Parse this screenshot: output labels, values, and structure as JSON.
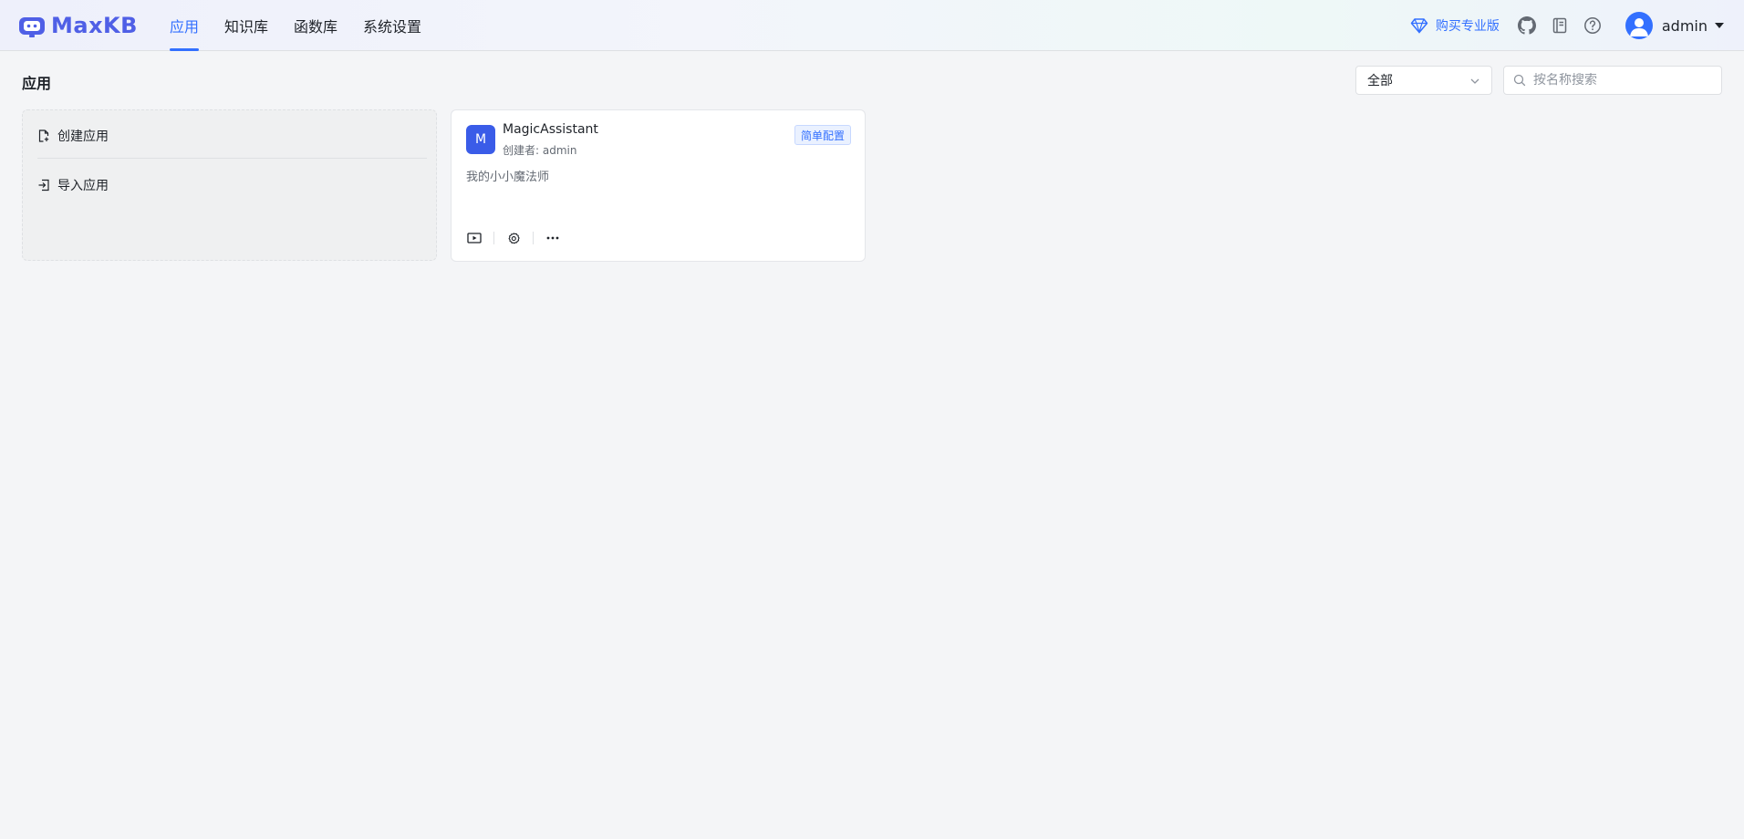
{
  "brand": {
    "name": "MaxKB",
    "color": "#4f5fe6"
  },
  "nav": {
    "items": [
      {
        "label": "应用",
        "active": true
      },
      {
        "label": "知识库",
        "active": false
      },
      {
        "label": "函数库",
        "active": false
      },
      {
        "label": "系统设置",
        "active": false
      }
    ]
  },
  "header": {
    "buy_pro": "购买专业版",
    "icons": [
      "github-icon",
      "book-icon",
      "help-icon"
    ],
    "user": {
      "name": "admin"
    }
  },
  "page": {
    "title": "应用",
    "filter": {
      "selected": "全部"
    },
    "search": {
      "placeholder": "按名称搜索",
      "value": ""
    }
  },
  "create_card": {
    "create_label": "创建应用",
    "import_label": "导入应用"
  },
  "apps": [
    {
      "initial": "M",
      "name": "MagicAssistant",
      "creator": "创建者: admin",
      "tag": "简单配置",
      "description": "我的小小魔法师",
      "avatar_color": "#3a5ce8"
    }
  ],
  "colors": {
    "accent": "#3370ff",
    "background": "#f4f5f7"
  }
}
